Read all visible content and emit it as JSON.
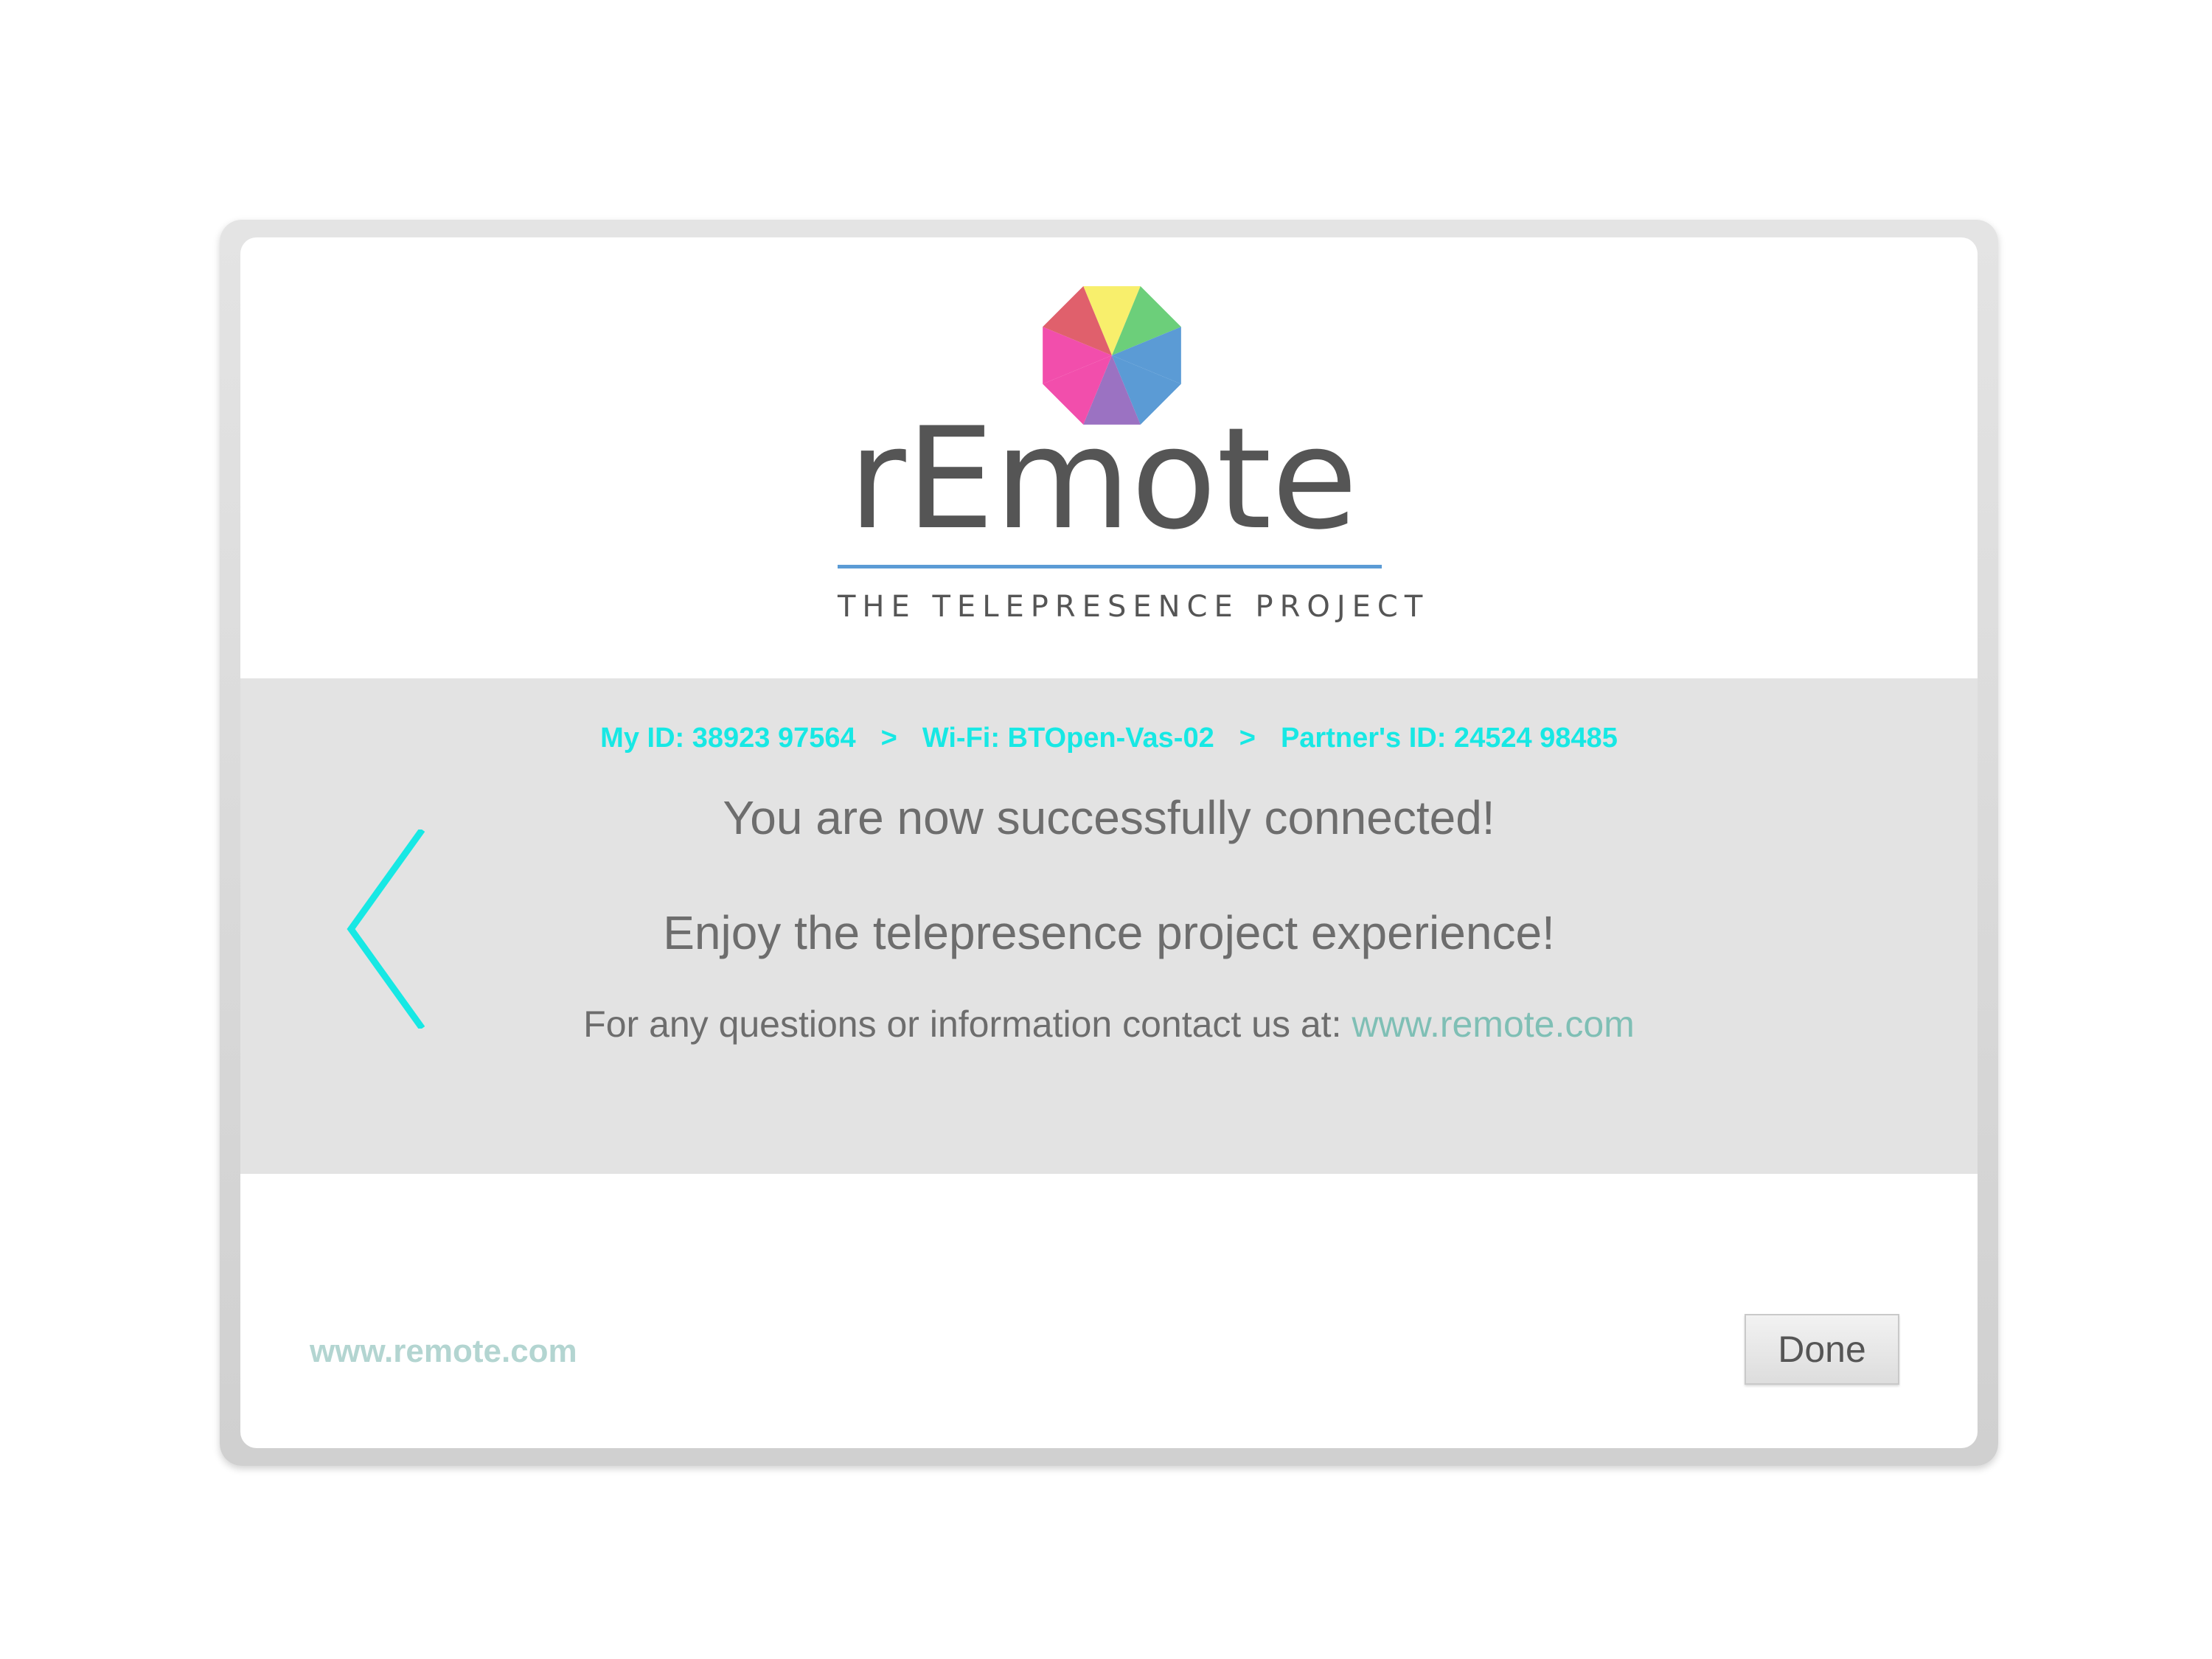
{
  "logo": {
    "wordmark": "rEmote",
    "tagline": "THE TELEPRESENCE PROJECT",
    "colors": {
      "wordmark": "#555555",
      "rule": "#5b9bd5",
      "petals": [
        "#f8ef6c",
        "#6ccf7a",
        "#5b9bd5",
        "#9b72c2",
        "#f24eac",
        "#e0606c"
      ]
    }
  },
  "breadcrumb": {
    "my_id": "My ID: 38923 97564",
    "separator": ">",
    "wifi": "Wi-Fi: BTOpen-Vas-02",
    "partner_id": "Partner's ID: 24524 98485",
    "color": "#17e8e4"
  },
  "message": {
    "connected": "You are now successfully connected!",
    "enjoy": "Enjoy the telepresence project experience!",
    "contact_prefix": "For any questions or information contact us at:",
    "contact_link": "www.remote.com"
  },
  "footer": {
    "website": "www.remote.com",
    "done_label": "Done"
  },
  "icons": {
    "back": "chevron-left-icon",
    "logo": "remote-logo-icon"
  }
}
